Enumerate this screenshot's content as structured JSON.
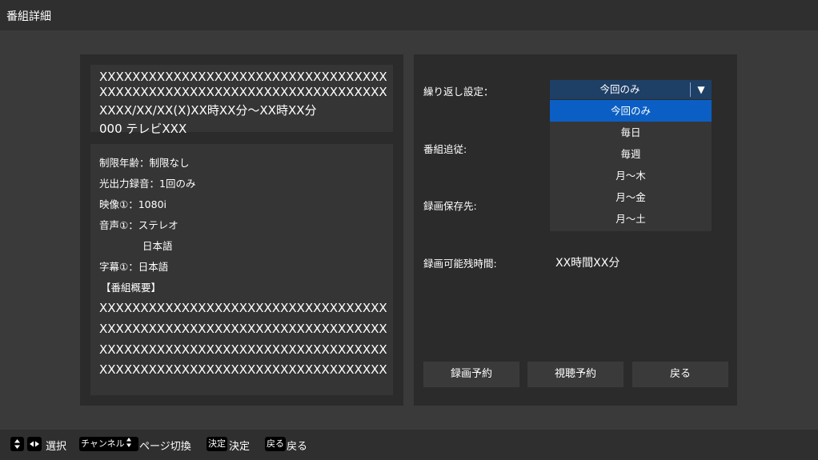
{
  "window": {
    "title": "番組詳細"
  },
  "program": {
    "title_lines": [
      "XXXXXXXXXXXXXXXXXXXXXXXXXXXXXXXXXXX",
      "XXXXXXXXXXXXXXXXXXXXXXXXXXXXXXXXXXX"
    ],
    "datetime": "XXXX/XX/XX(X)XX時XX分～XX時XX分",
    "channel": "000 テレビXXX",
    "details": {
      "age_limit": "制限年齢：制限なし",
      "optical_recording": "光出力録音：1回のみ",
      "video": "映像①：1080i",
      "audio": "音声①：ステレオ",
      "audio_language": "日本語",
      "subtitle": "字幕①：日本語",
      "summary_header": "【番組概要】",
      "summary_lines": [
        "XXXXXXXXXXXXXXXXXXXXXXXXXXXXXXXXXXX",
        "XXXXXXXXXXXXXXXXXXXXXXXXXXXXXXXXXXX",
        "XXXXXXXXXXXXXXXXXXXXXXXXXXXXXXXXXXX",
        "XXXXXXXXXXXXXXXXXXXXXXXXXXXXXXXXXXX"
      ]
    }
  },
  "settings": {
    "repeat_label": "繰り返し設定：",
    "repeat_value": "今回のみ",
    "repeat_options": [
      "今回のみ",
      "毎日",
      "毎週",
      "月～木",
      "月～金",
      "月～土"
    ],
    "follow_label": "番組追従:",
    "destination_label": "録画保存先:",
    "remaining_label": "録画可能残時間:",
    "remaining_value": "XX時間XX分"
  },
  "buttons": {
    "record": "録画予約",
    "watch": "視聴予約",
    "back": "戻る"
  },
  "footer": {
    "select_label": "選択",
    "channel_key": "チャンネル",
    "page_label": "ページ切換",
    "decide_key": "決定",
    "decide_label": "決定",
    "back_key": "戻る",
    "back_label": "戻る"
  },
  "colors": {
    "background": "#3a3a3a",
    "panel": "#2b2b2b",
    "dropdown_value_bg": "#1e3f66",
    "selected_option": "#0b5fc4"
  }
}
